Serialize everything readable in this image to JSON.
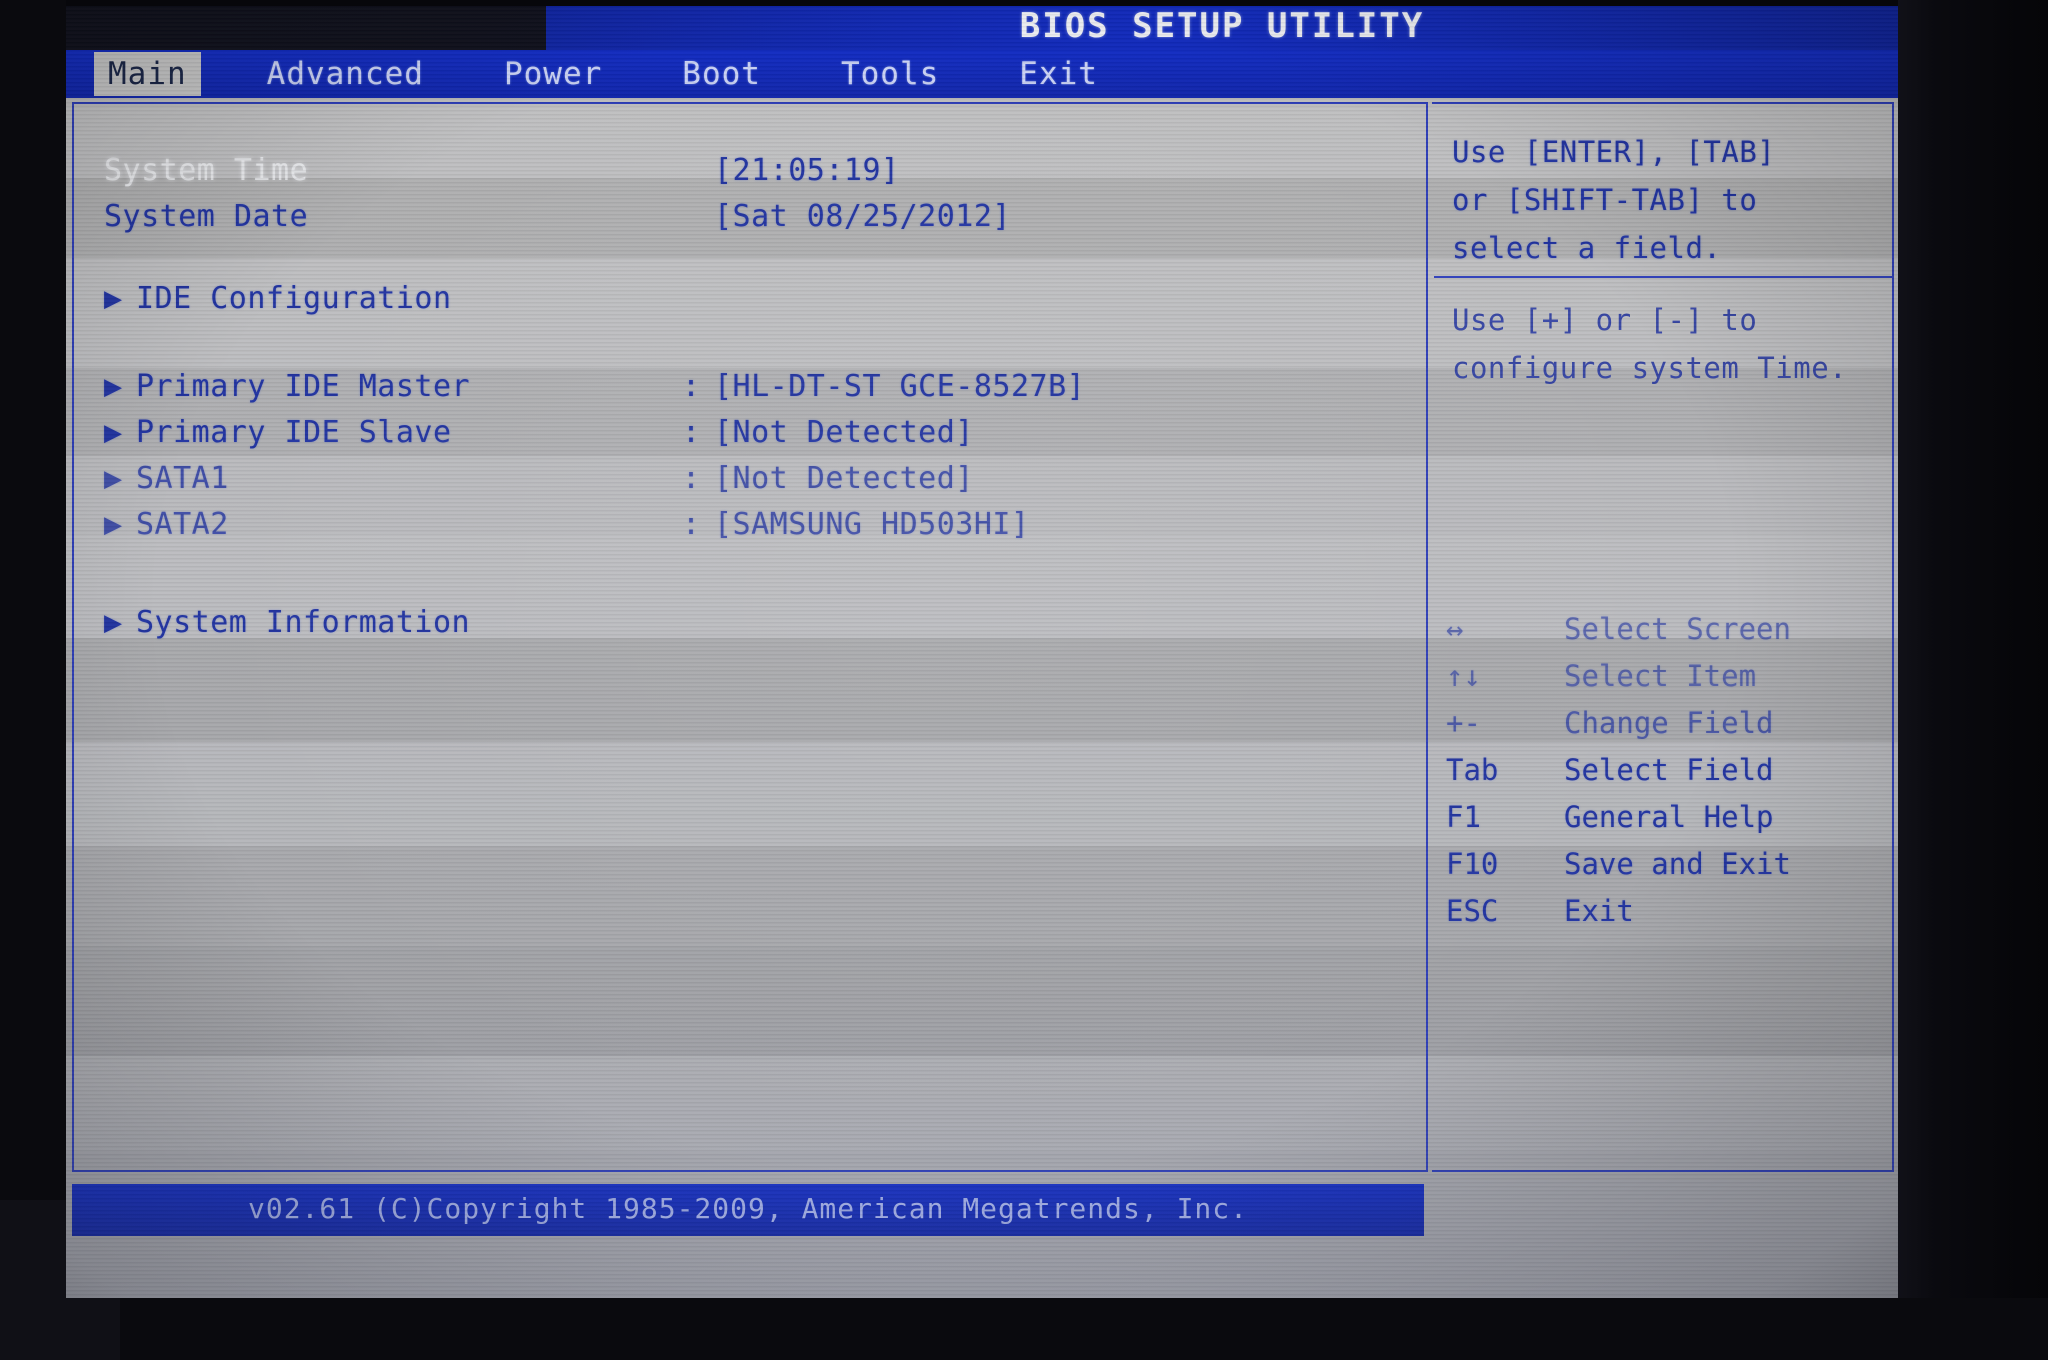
{
  "window": {
    "title": "BIOS SETUP UTILITY"
  },
  "menu": {
    "items": [
      {
        "label": "Main",
        "active": true
      },
      {
        "label": "Advanced",
        "active": false
      },
      {
        "label": "Power",
        "active": false
      },
      {
        "label": "Boot",
        "active": false
      },
      {
        "label": "Tools",
        "active": false
      },
      {
        "label": "Exit",
        "active": false
      }
    ]
  },
  "main": {
    "system_time": {
      "label": "System Time",
      "value": "[21:05:19]"
    },
    "system_date": {
      "label": "System Date",
      "value": "[Sat 08/25/2012]"
    },
    "ide_configuration": {
      "arrow": "▶",
      "label": "IDE Configuration"
    },
    "devices": [
      {
        "arrow": "▶",
        "label": "Primary IDE Master",
        "colon": ":",
        "value": "[HL-DT-ST GCE-8527B]"
      },
      {
        "arrow": "▶",
        "label": "Primary IDE Slave",
        "colon": ":",
        "value": "[Not Detected]"
      },
      {
        "arrow": "▶",
        "label": "SATA1",
        "colon": ":",
        "value": "[Not Detected]"
      },
      {
        "arrow": "▶",
        "label": "SATA2",
        "colon": ":",
        "value": "[SAMSUNG HD503HI]"
      }
    ],
    "system_information": {
      "arrow": "▶",
      "label": "System Information"
    }
  },
  "help": {
    "line1": "Use [ENTER], [TAB]",
    "line2": "or [SHIFT-TAB] to",
    "line3": "select a field.",
    "line4": "Use [+] or [-] to",
    "line5": "configure system Time."
  },
  "keys": [
    {
      "key": "↔",
      "desc": "Select Screen"
    },
    {
      "key": "↑↓",
      "desc": "Select Item"
    },
    {
      "key": "+-",
      "desc": "Change Field"
    },
    {
      "key": "Tab",
      "desc": "Select Field"
    },
    {
      "key": "F1",
      "desc": "General Help"
    },
    {
      "key": "F10",
      "desc": "Save and Exit"
    },
    {
      "key": "ESC",
      "desc": "Exit"
    }
  ],
  "footer": {
    "text": "v02.61 (C)Copyright 1985-2009, American Megatrends, Inc."
  },
  "colors": {
    "menu_bar_blue": "#0c24b6",
    "text_blue": "#1d2f9e",
    "screen_gray": "#b9b8b4",
    "highlight_white": "#f0f0ee"
  }
}
